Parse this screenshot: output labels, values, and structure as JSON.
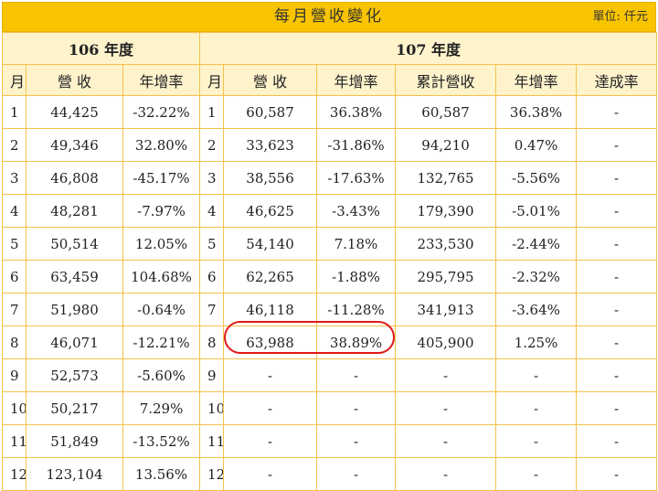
{
  "title": "每月營收變化",
  "unit_label": "單位: 仟元",
  "years": {
    "y106": "106 年度",
    "y107": "107 年度"
  },
  "headers": [
    "月",
    "營 收",
    "年增率",
    "月",
    "營 收",
    "年增率",
    "累計營收",
    "年增率",
    "達成率"
  ],
  "rows": [
    [
      "1",
      "44,425",
      "-32.22%",
      "1",
      "60,587",
      "36.38%",
      "60,587",
      "36.38%",
      "-"
    ],
    [
      "2",
      "49,346",
      "32.80%",
      "2",
      "33,623",
      "-31.86%",
      "94,210",
      "0.47%",
      "-"
    ],
    [
      "3",
      "46,808",
      "-45.17%",
      "3",
      "38,556",
      "-17.63%",
      "132,765",
      "-5.56%",
      "-"
    ],
    [
      "4",
      "48,281",
      "-7.97%",
      "4",
      "46,625",
      "-3.43%",
      "179,390",
      "-5.01%",
      "-"
    ],
    [
      "5",
      "50,514",
      "12.05%",
      "5",
      "54,140",
      "7.18%",
      "233,530",
      "-2.44%",
      "-"
    ],
    [
      "6",
      "63,459",
      "104.68%",
      "6",
      "62,265",
      "-1.88%",
      "295,795",
      "-2.32%",
      "-"
    ],
    [
      "7",
      "51,980",
      "-0.64%",
      "7",
      "46,118",
      "-11.28%",
      "341,913",
      "-3.64%",
      "-"
    ],
    [
      "8",
      "46,071",
      "-12.21%",
      "8",
      "63,988",
      "38.89%",
      "405,900",
      "1.25%",
      "-"
    ],
    [
      "9",
      "52,573",
      "-5.60%",
      "9",
      "-",
      "-",
      "-",
      "-",
      "-"
    ],
    [
      "10",
      "50,217",
      "7.29%",
      "10",
      "-",
      "-",
      "-",
      "-",
      "-"
    ],
    [
      "11",
      "51,849",
      "-13.52%",
      "11",
      "-",
      "-",
      "-",
      "-",
      "-"
    ],
    [
      "12",
      "123,104",
      "13.56%",
      "12",
      "-",
      "-",
      "-",
      "-",
      "-"
    ]
  ],
  "colors": {
    "header_bar": "#f8c400",
    "header_cell": "#fff3cc",
    "border": "#f3c24a",
    "highlight": "#e01818"
  }
}
